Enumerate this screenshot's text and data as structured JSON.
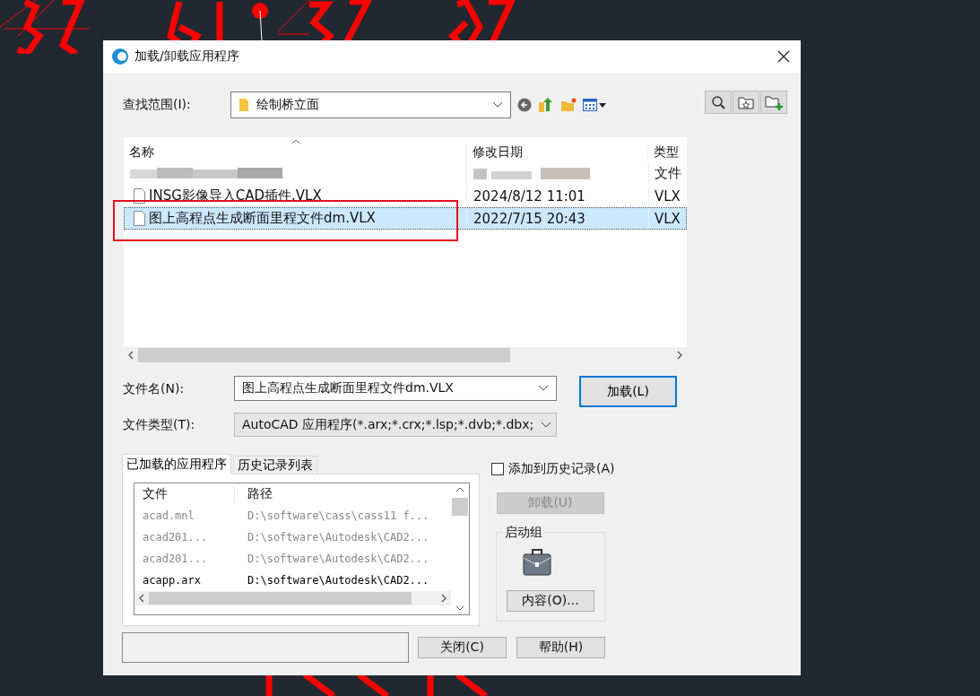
{
  "window": {
    "title": "加载/卸载应用程序"
  },
  "look_in": {
    "label": "查找范围(I):",
    "value": "绘制桥立面"
  },
  "file_list": {
    "columns": [
      "名称",
      "修改日期",
      "类型"
    ],
    "rows": [
      {
        "kind": "redacted",
        "type": "文件",
        "selected": false
      },
      {
        "kind": "file",
        "name": "INSG影像导入CAD插件.VLX",
        "date": "2024/8/12 11:01",
        "type": "VLX",
        "selected": false
      },
      {
        "kind": "file",
        "name": "图上高程点生成断面里程文件dm.VLX",
        "date": "2022/7/15 20:43",
        "type": "VLX",
        "selected": true
      }
    ]
  },
  "file_name": {
    "label": "文件名(N):",
    "value": "图上高程点生成断面里程文件dm.VLX"
  },
  "file_type": {
    "label": "文件类型(T):",
    "value": "AutoCAD 应用程序(*.arx;*.crx;*.lsp;*.dvb;*.dbx;"
  },
  "load_button": "加载(L)",
  "tabs": [
    {
      "label": "已加载的应用程序",
      "selected": true
    },
    {
      "label": "历史记录列表",
      "selected": false
    }
  ],
  "loaded_apps": {
    "columns": [
      "文件",
      "路径"
    ],
    "rows": [
      {
        "file": "acad.mnl",
        "path": "D:\\software\\cass\\cass11 f...",
        "disabled": true
      },
      {
        "file": "acad201...",
        "path": "D:\\software\\Autodesk\\CAD2...",
        "disabled": true
      },
      {
        "file": "acad201...",
        "path": "D:\\software\\Autodesk\\CAD2...",
        "disabled": true
      },
      {
        "file": "acapp.arx",
        "path": "D:\\software\\Autodesk\\CAD2...",
        "disabled": false
      }
    ]
  },
  "add_to_history": {
    "label": "添加到历史记录(A)",
    "checked": false
  },
  "unload_button": {
    "label": "卸载(U)",
    "disabled": true
  },
  "startup_group": {
    "title": "启动组",
    "contents_button": "内容(O)..."
  },
  "buttons": [
    "关闭(C)",
    "帮助(H)"
  ]
}
